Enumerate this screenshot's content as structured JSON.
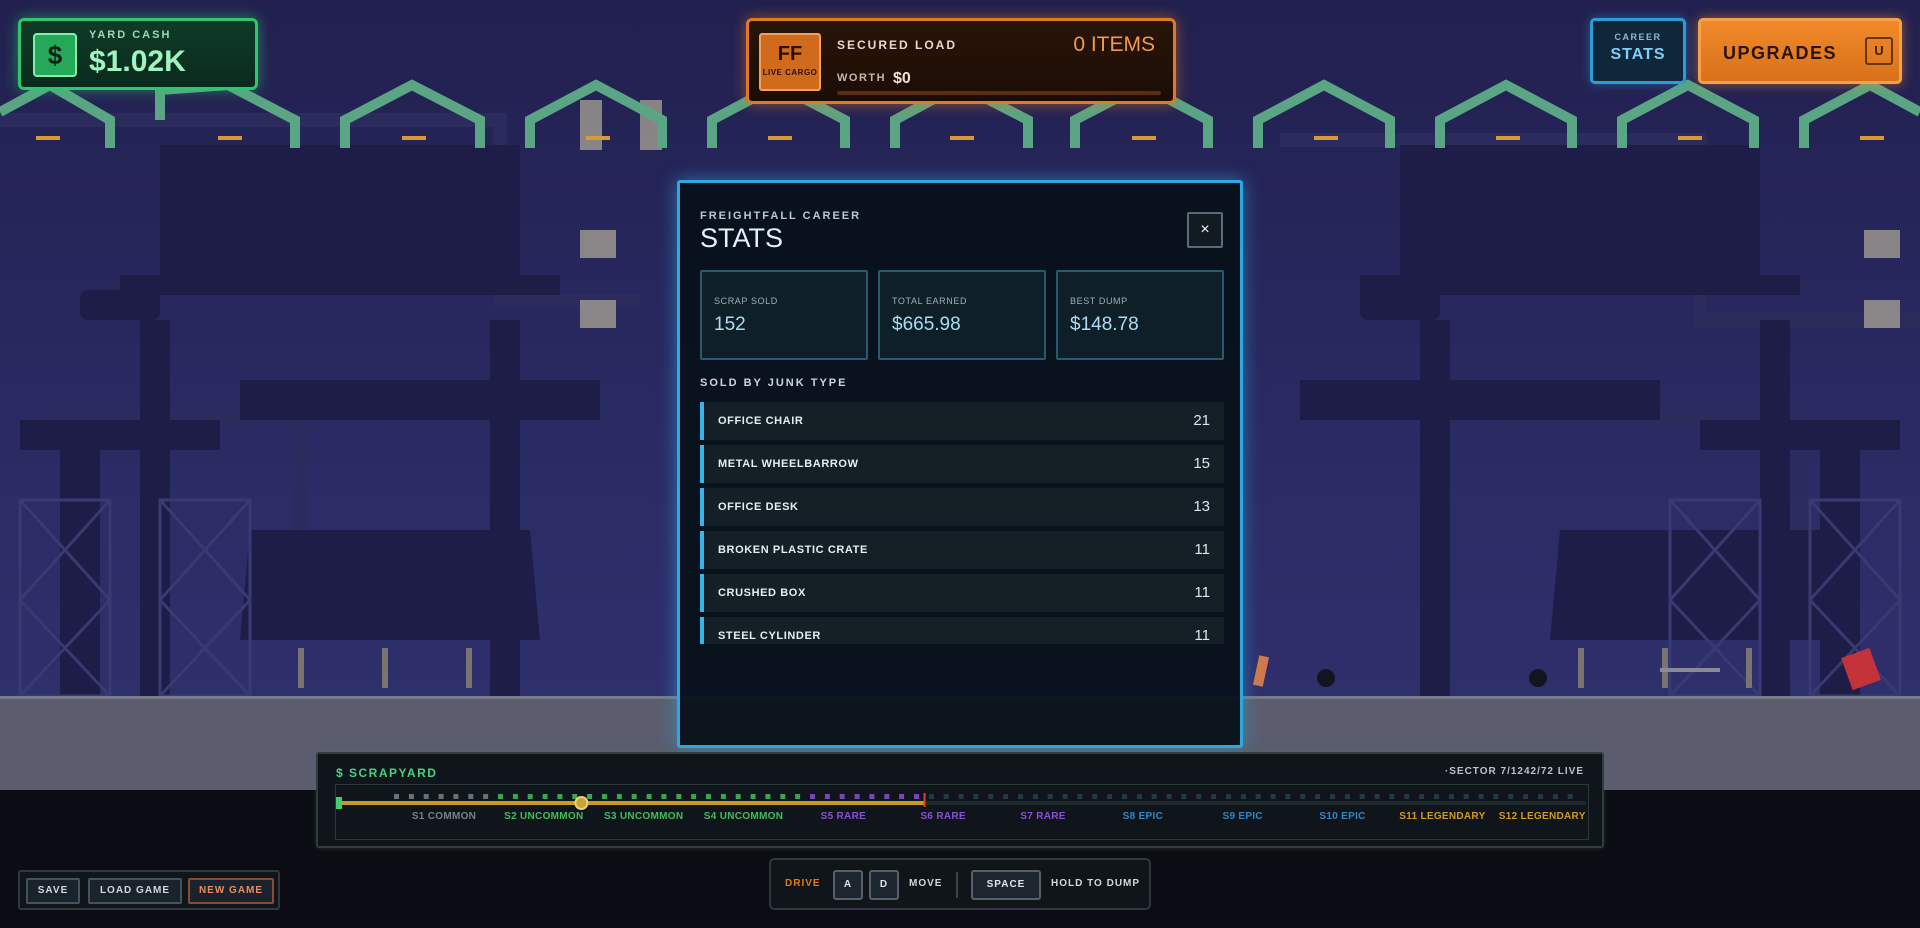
{
  "hud": {
    "cash_label": "YARD CASH",
    "cash_icon": "$",
    "cash_value": "$1.02K",
    "load_badge": "FF",
    "load_badge_sub": "LIVE CARGO",
    "load_title": "SECURED LOAD",
    "load_items": "0 ITEMS",
    "load_worth_label": "WORTH",
    "load_worth_value": "$0",
    "stats_small": "CAREER",
    "stats_big": "STATS",
    "upgrades_label": "UPGRADES",
    "upgrades_key": "U"
  },
  "modal": {
    "kicker": "FREIGHTFALL CAREER",
    "title": "STATS",
    "close_label": "×",
    "cards": [
      {
        "label": "SCRAP SOLD",
        "value": "152"
      },
      {
        "label": "TOTAL EARNED",
        "value": "$665.98"
      },
      {
        "label": "BEST DUMP",
        "value": "$148.78"
      }
    ],
    "section_label": "SOLD BY JUNK TYPE",
    "junk": [
      {
        "name": "OFFICE CHAIR",
        "count": "21"
      },
      {
        "name": "METAL WHEELBARROW",
        "count": "15"
      },
      {
        "name": "OFFICE DESK",
        "count": "13"
      },
      {
        "name": "BROKEN PLASTIC CRATE",
        "count": "11"
      },
      {
        "name": "CRUSHED BOX",
        "count": "11"
      },
      {
        "name": "STEEL CYLINDER",
        "count": "11"
      }
    ]
  },
  "track": {
    "title": "$ SCRAPYARD",
    "status": "·SECTOR 7/1242/72 LIVE",
    "progress": 0.47,
    "player_position": 0.195,
    "sectors": [
      {
        "label": "S1 COMMON",
        "color": "#7a8088"
      },
      {
        "label": "S2 UNCOMMON",
        "color": "#3fbf5a"
      },
      {
        "label": "S3 UNCOMMON",
        "color": "#3fbf5a"
      },
      {
        "label": "S4 UNCOMMON",
        "color": "#3fbf5a"
      },
      {
        "label": "S5 RARE",
        "color": "#8a4fd6"
      },
      {
        "label": "S6 RARE",
        "color": "#8a4fd6"
      },
      {
        "label": "S7 RARE",
        "color": "#8a4fd6"
      },
      {
        "label": "S8 EPIC",
        "color": "#2f88c8"
      },
      {
        "label": "S9 EPIC",
        "color": "#2f88c8"
      },
      {
        "label": "S10 EPIC",
        "color": "#2f88c8"
      },
      {
        "label": "S11 LEGENDARY",
        "color": "#d29a1e"
      },
      {
        "label": "S12 LEGENDARY",
        "color": "#d29a1e"
      }
    ]
  },
  "file": {
    "save": "SAVE",
    "load": "LOAD GAME",
    "new": "NEW GAME"
  },
  "controls": {
    "drive": "DRIVE",
    "key_a": "A",
    "key_d": "D",
    "move": "MOVE",
    "key_space": "SPACE",
    "dump": "HOLD TO DUMP"
  },
  "colors": {
    "cash": "#2fc76a",
    "cargo": "#e07a22",
    "stats": "#2a9ed6",
    "modal_border": "#2ea8e0"
  }
}
